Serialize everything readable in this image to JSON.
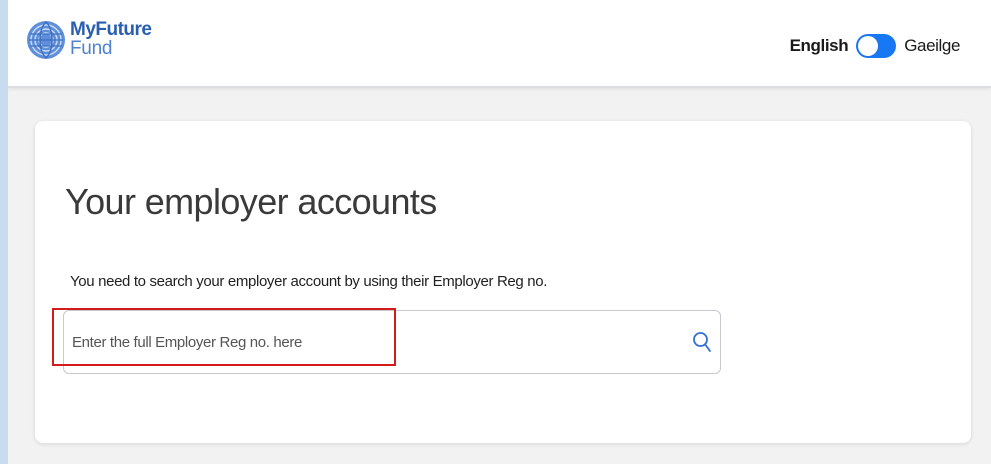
{
  "header": {
    "logo": {
      "line1": "MyFuture",
      "line2": "Fund",
      "icon": "myfuturefund-logo-icon",
      "brand_color": "#2a5fb0"
    },
    "language": {
      "english_label": "English",
      "gaeilge_label": "Gaeilge",
      "toggle_color": "#1877f2"
    }
  },
  "main": {
    "title": "Your employer accounts",
    "instruction": "You need to search your employer account by using their Employer Reg no.",
    "search": {
      "placeholder": "Enter the full Employer Reg no. here",
      "value": "",
      "icon": "search-icon"
    },
    "highlight_color": "#d21b1b"
  }
}
